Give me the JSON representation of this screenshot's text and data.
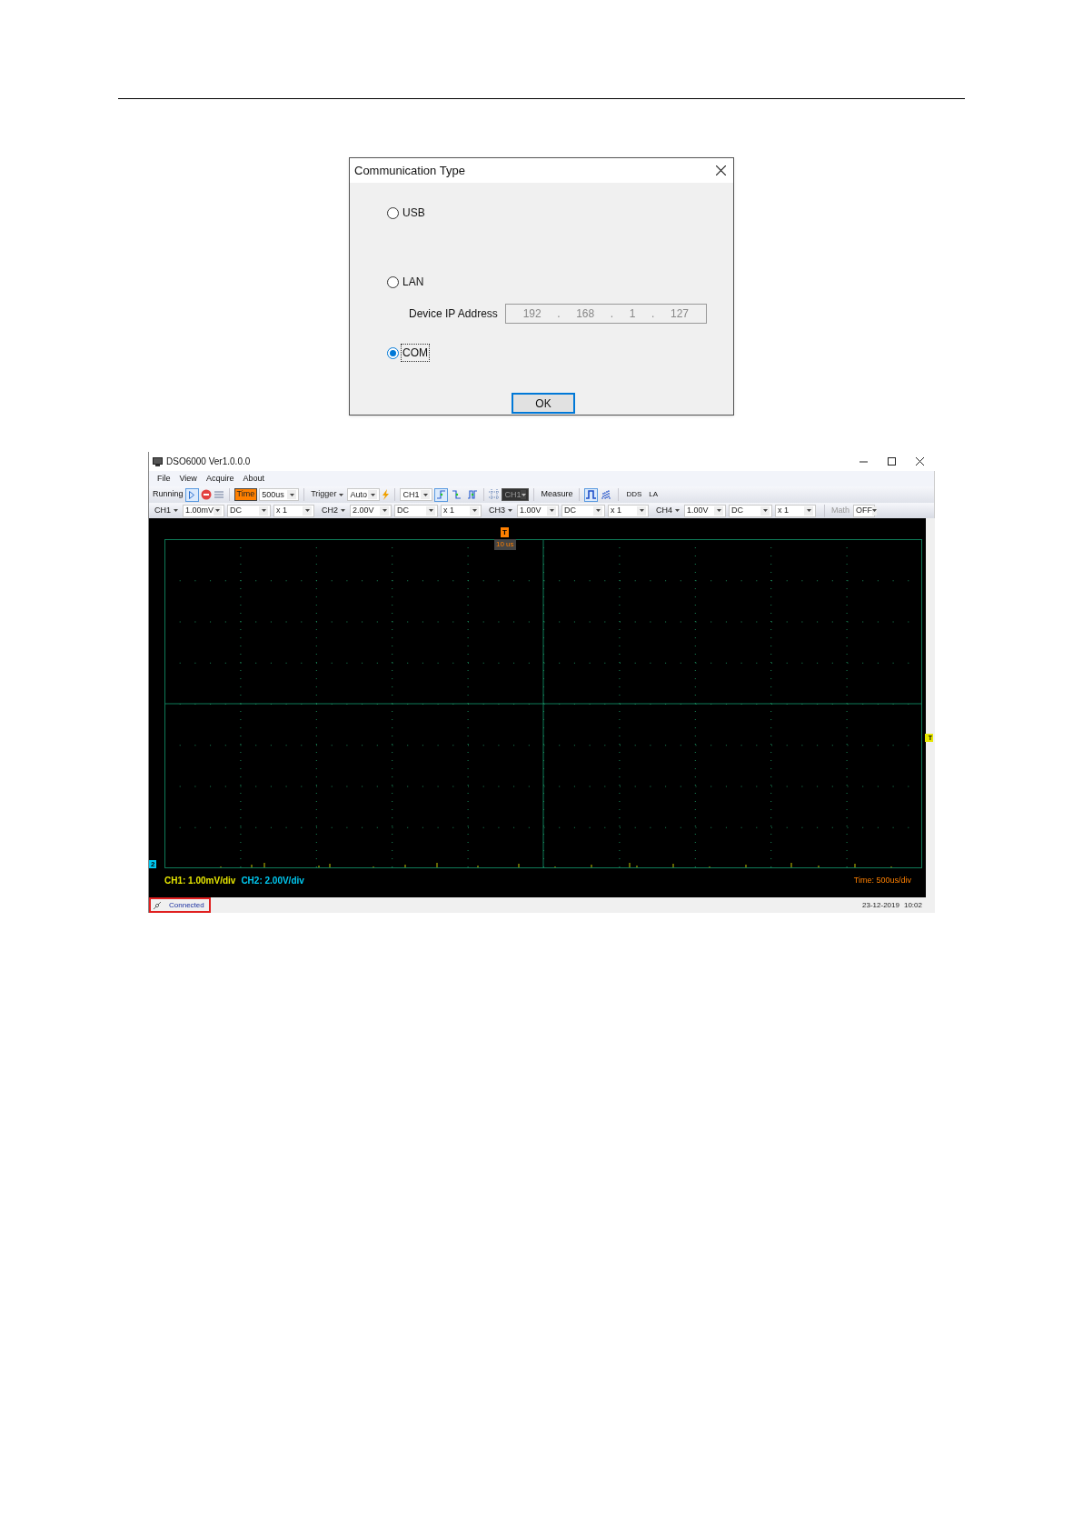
{
  "dialog": {
    "title": "Communication Type",
    "options": [
      {
        "label": "USB",
        "selected": false
      },
      {
        "label": "LAN",
        "selected": false
      },
      {
        "label": "COM",
        "selected": true
      }
    ],
    "ip_field": {
      "label": "Device IP Address",
      "parts": [
        "192",
        ".",
        "168",
        ".",
        "1",
        ".",
        "127"
      ],
      "disabled": true
    },
    "ok_button": "OK"
  },
  "app_window": {
    "title": "DSO6000 Ver1.0.0.0",
    "menu": [
      "File",
      "View",
      "Acquire",
      "About"
    ],
    "toolbar": {
      "running_label": "Running",
      "time_label": "Time",
      "time_value": "500us",
      "trigger_label": "Trigger",
      "trigger_mode": "Auto",
      "trigger_source": "CH1",
      "edges": [
        {
          "selected": true
        },
        {
          "selected": false
        },
        {
          "selected": false
        }
      ],
      "cursor_channel": {
        "value": "CH1",
        "disabled": true
      },
      "measure_label": "Measure",
      "pulse_modes": [
        {
          "selected": true
        },
        {
          "selected": false
        }
      ],
      "extras": [
        "DDS",
        "LA"
      ]
    },
    "channels": [
      {
        "name": "CH1",
        "volts": "1.00mV",
        "coupling": "DC",
        "probe": "x 1"
      },
      {
        "name": "CH2",
        "volts": "2.00V",
        "coupling": "DC",
        "probe": "x 1"
      },
      {
        "name": "CH3",
        "volts": "1.00V",
        "coupling": "DC",
        "probe": "x 1"
      },
      {
        "name": "CH4",
        "volts": "1.00V",
        "coupling": "DC",
        "probe": "x 1"
      }
    ],
    "math": {
      "label": "Math",
      "value": "OFF",
      "disabled": true
    },
    "screen": {
      "trigger_marker": "T",
      "time_offset": "10 us",
      "channel_marker": "2",
      "level_marker": "T",
      "legend": [
        {
          "text": "CH1: 1.00mV/div",
          "color": "#e6e600"
        },
        {
          "text": "CH2: 2.00V/div",
          "color": "#00c8f0"
        }
      ],
      "time_scale": "Time: 500us/div"
    },
    "status_bar": {
      "connection": "Connected",
      "date": "23-12-2019",
      "time": "10:02"
    }
  }
}
